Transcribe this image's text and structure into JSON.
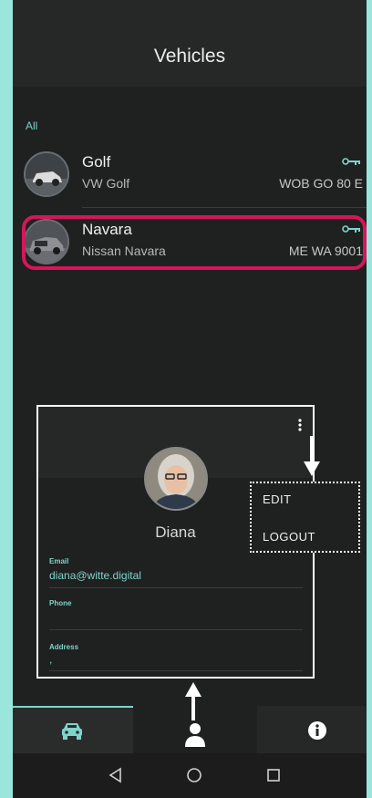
{
  "header": {
    "title": "Vehicles"
  },
  "list": {
    "section_label": "All",
    "vehicles": [
      {
        "name": "Golf",
        "model": "VW Golf",
        "plate": "WOB GO 80 E"
      },
      {
        "name": "Navara",
        "model": "Nissan Navara",
        "plate": "ME WA 9001"
      }
    ]
  },
  "profile": {
    "name": "Diana",
    "email_label": "Email",
    "email_value": "diana@witte.digital",
    "phone_label": "Phone",
    "phone_value": "",
    "address_label": "Address",
    "address_value": ","
  },
  "menu": {
    "edit": "EDIT",
    "logout": "LOGOUT"
  },
  "nav": {
    "tabs": [
      "vehicles",
      "profile",
      "info"
    ],
    "active": "vehicles"
  },
  "colors": {
    "accent": "#7fd4ca",
    "highlight": "#d6155a",
    "background": "#1f2020"
  },
  "icons": [
    "key-icon",
    "kebab-menu-icon",
    "car-icon",
    "person-icon",
    "info-icon",
    "back-icon",
    "home-icon",
    "recents-icon"
  ]
}
